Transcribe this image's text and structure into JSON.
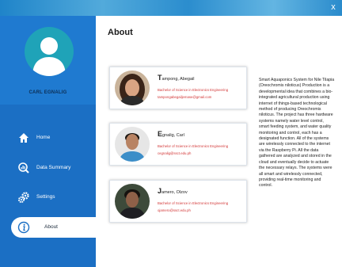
{
  "window": {
    "close_label": "x"
  },
  "sidebar": {
    "user_name": "CARL EGNALIG",
    "items": [
      {
        "label": "Home",
        "icon": "home-icon"
      },
      {
        "label": "Data Summary",
        "icon": "chart-search-icon"
      },
      {
        "label": "Settings",
        "icon": "gears-icon"
      },
      {
        "label": "About",
        "icon": "info-icon"
      }
    ],
    "active_item": "About"
  },
  "main": {
    "title": "About",
    "members": [
      {
        "initial": "T",
        "name_rest": "ampong, Abegail",
        "degree": "Bachelor of Science in Electronics Engineering",
        "email": "tampongabegailjemase@gmail.com"
      },
      {
        "initial": "E",
        "name_rest": "gnalig, Carl",
        "degree": "Bachelor of Science in Electronics Engineering",
        "email": "cegnalig@ssct.edu.ph"
      },
      {
        "initial": "J",
        "name_rest": "amero, Olzov",
        "degree": "Bachelor of Science in Electronics Engineering",
        "email": "ojamero@ssct.edu.ph"
      }
    ],
    "description": "Smart Aquaponics System for Nile Tilapia (Oreochromis niloticus) Production is a developmental idea that combines a bio-integrated agricultural production using internet of things-based technological method of producing Oreochromis niloticus. The project has three hardware systems namely water level control, smart feeding system, and water quality monitoring and control, each has a designated function. All of the systems are wirelessly connected to the internet via the Raspberry Pi. All the data gathered are analyzed and stored in the cloud and eventually decide to actuate the necessary relays. The systems were all smart and wirelessly connected, providing real-time monitoring and control."
  },
  "colors": {
    "sidebar": "#1b6fc4",
    "avatar": "#1fa3b8",
    "accent_text": "#d23535"
  }
}
